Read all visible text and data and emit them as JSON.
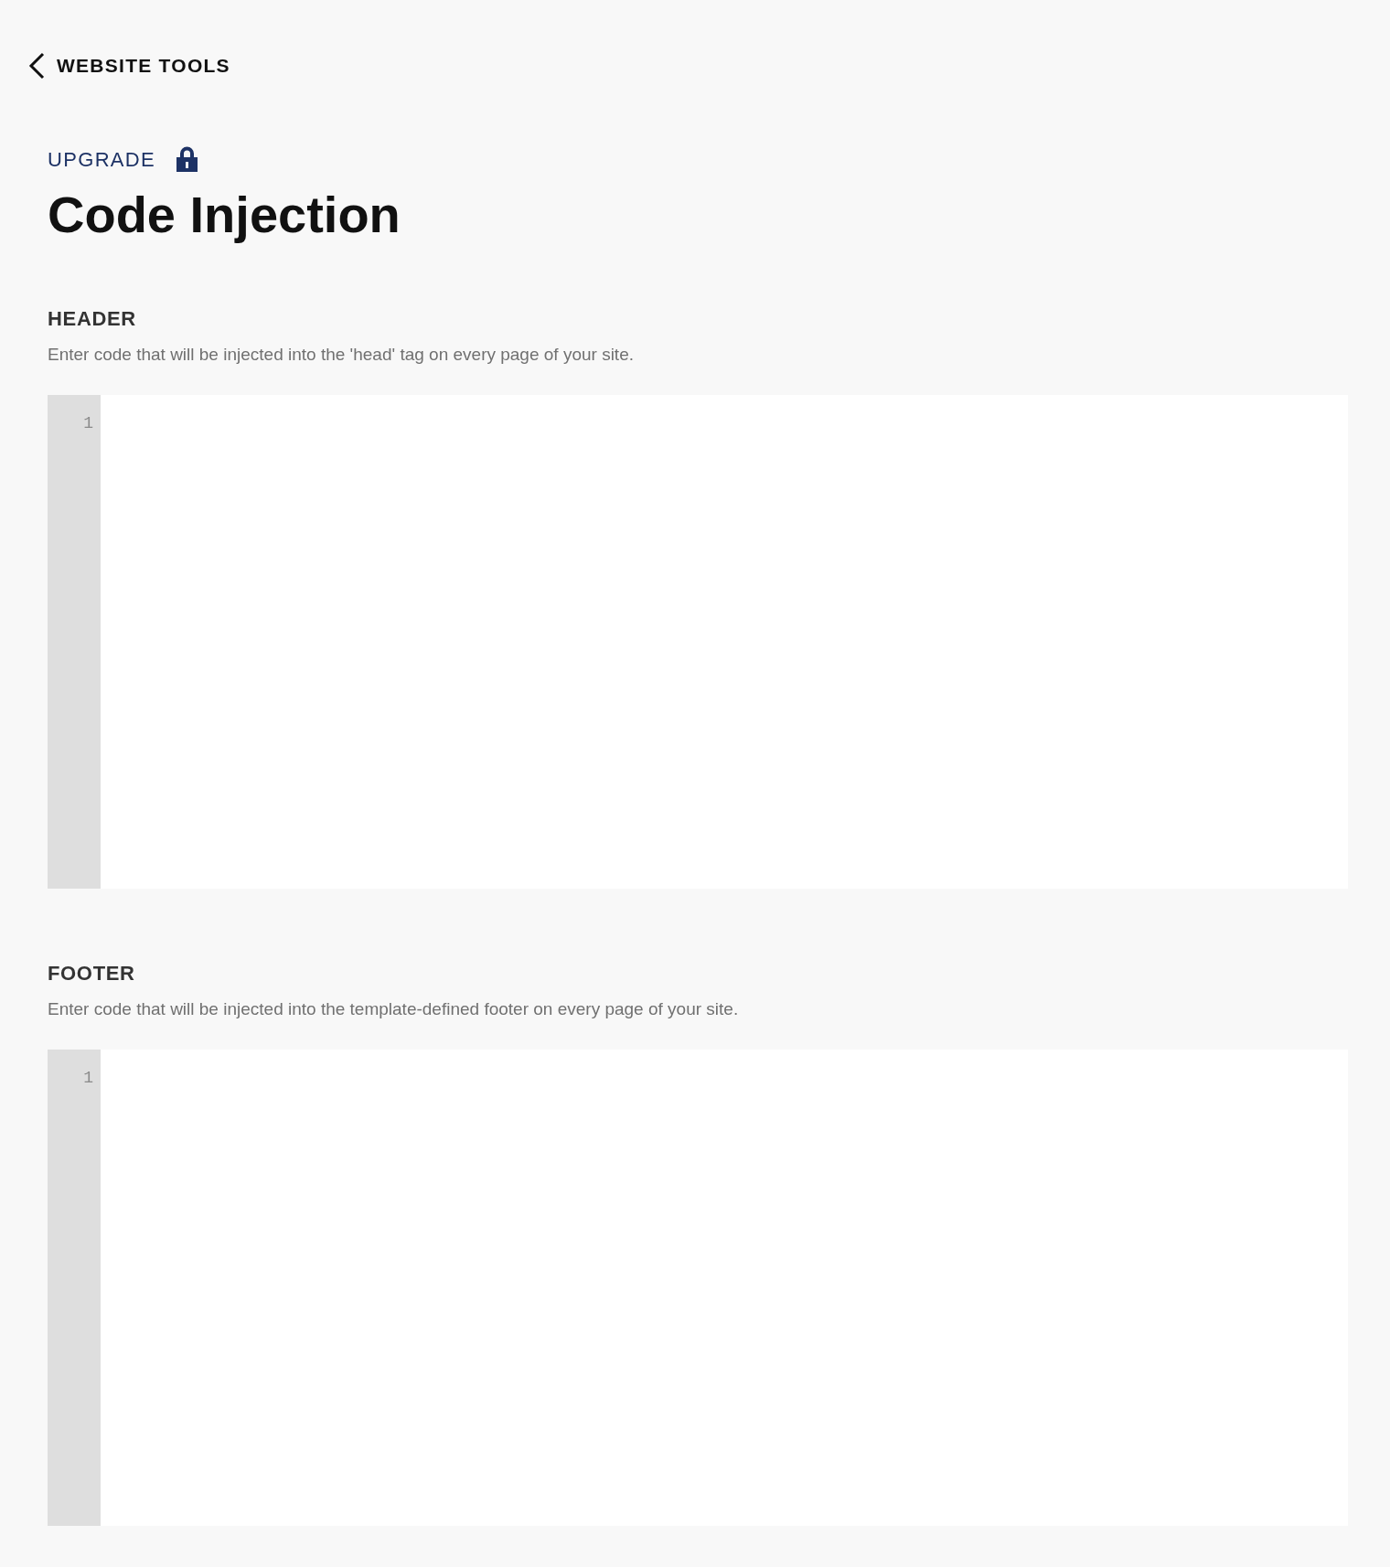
{
  "back_link": {
    "label": "WEBSITE TOOLS"
  },
  "upgrade": {
    "label": "UPGRADE",
    "locked": true
  },
  "title": "Code Injection",
  "sections": [
    {
      "heading": "HEADER",
      "description": "Enter code that will be injected into the 'head' tag on every page of your site.",
      "line_numbers": [
        "1"
      ]
    },
    {
      "heading": "FOOTER",
      "description": "Enter code that will be injected into the template-defined footer on every page of your site.",
      "line_numbers": [
        "1"
      ]
    }
  ]
}
